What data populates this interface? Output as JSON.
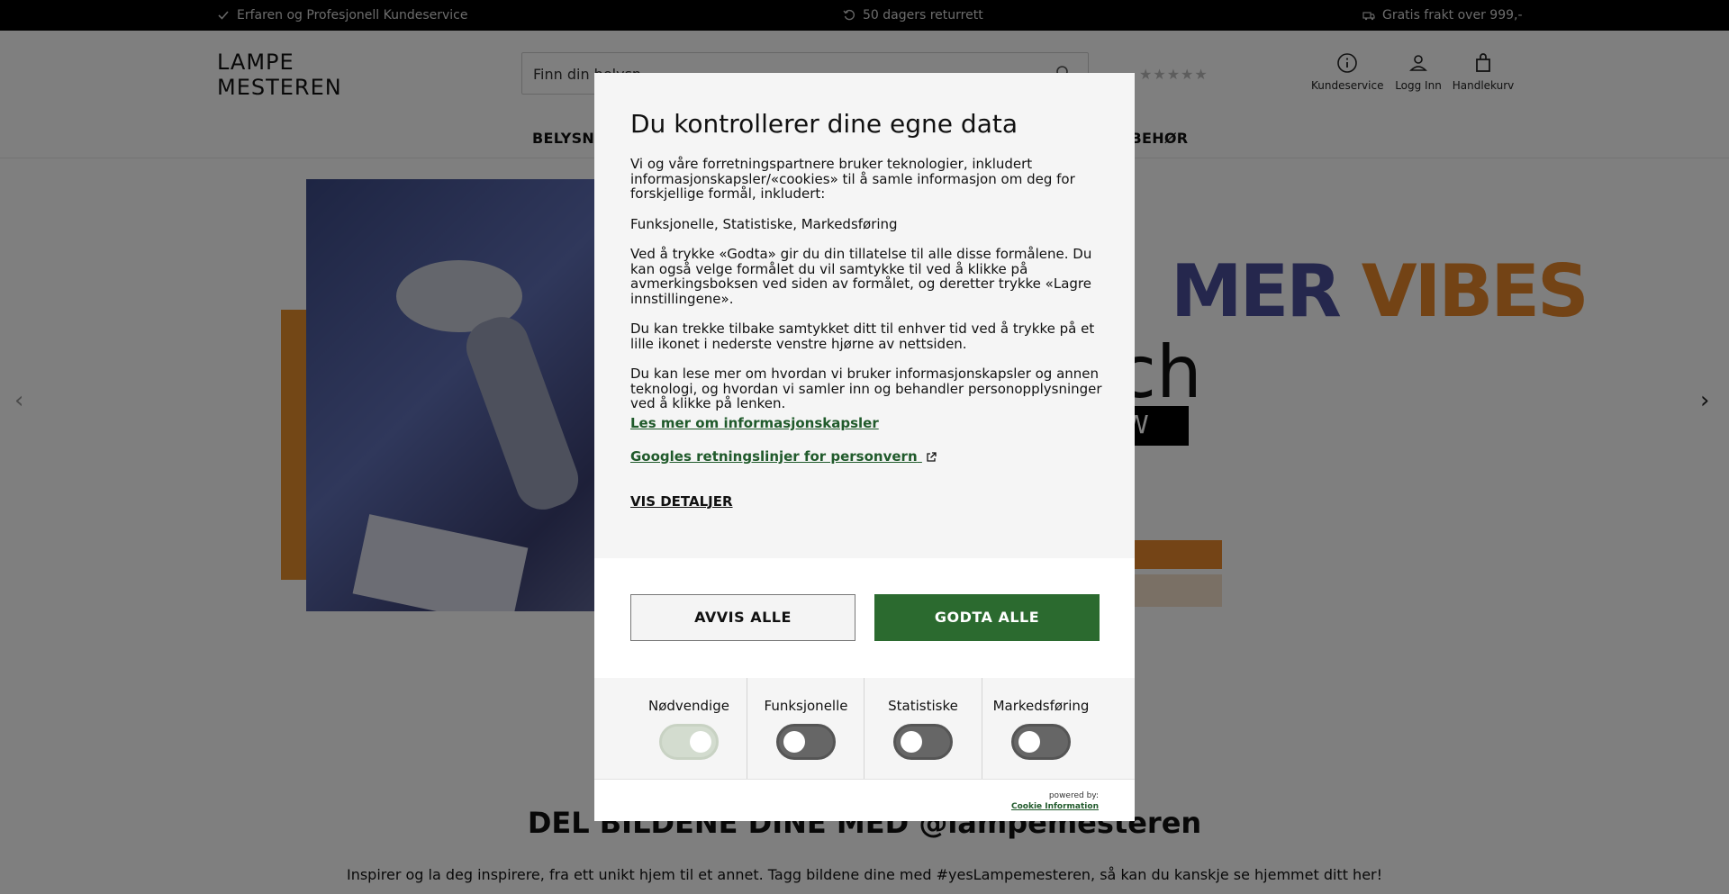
{
  "topbar": {
    "items": [
      {
        "icon": "check-icon",
        "label": "Erfaren og Profesjonell Kundeservice"
      },
      {
        "icon": "return-icon",
        "label": "50 dagers returrett"
      },
      {
        "icon": "truck-icon",
        "label": "Gratis frakt over 999,-"
      }
    ]
  },
  "header": {
    "logo_text": "LAMPE MESTEREN",
    "search": {
      "placeholder": "Finn din belysning",
      "value": "Finn din belysn"
    },
    "rating_stars": "★★★★★",
    "icons": [
      {
        "icon": "info-icon",
        "label": "Kundeservice"
      },
      {
        "icon": "user-icon",
        "label": "Logg Inn"
      },
      {
        "icon": "bag-icon",
        "label": "Handlekurv"
      }
    ],
    "nav": {
      "left": "BELYSNI",
      "right": "LBEHØR"
    }
  },
  "hero": {
    "headline_part1": "MER",
    "headline_part2": "VIBES",
    "subline": "ch",
    "button_text": "W",
    "prev_arrow": "‹",
    "next_arrow": "›"
  },
  "share": {
    "title": "DEL BILDENE DINE MED @lampemesteren",
    "subtitle": "Inspirer og la deg inspirere, fra ett unikt hjem til et annet. Tagg bildene dine med #yesLampemesteren, så kan du kanskje se hjemmet ditt her!"
  },
  "cookie_modal": {
    "title": "Du kontrollerer dine egne data",
    "paragraphs": [
      "Vi og våre forretningspartnere bruker teknologier, inkludert informasjonskapsler/«cookies» til å samle informasjon om deg for forskjellige formål, inkludert:",
      "Funksjonelle, Statistiske, Markedsføring",
      "Ved å trykke «Godta» gir du din tillatelse til alle disse formålene. Du kan også velge formålet du vil samtykke til ved å klikke på avmerkingsboksen ved siden av formålet, og deretter trykke «Lagre innstillingene».",
      "Du kan trekke tilbake samtykket ditt til enhver tid ved å trykke på et lille ikonet i nederste venstre hjørne av nettsiden.",
      "Du kan lese mer om hvordan vi bruker informasjonskapsler og annen teknologi, og hvordan vi samler inn og behandler personopplysninger ved å klikke på lenken."
    ],
    "link_cookies": "Les mer om informasjonskapsler",
    "link_google": "Googles retningslinjer for personvern",
    "details": "VIS DETALJER",
    "reject_all": "AVVIS ALLE",
    "accept_all": "GODTA ALLE",
    "categories": [
      {
        "label": "Nødvendige",
        "state": "on"
      },
      {
        "label": "Funksjonelle",
        "state": "off"
      },
      {
        "label": "Statistiske",
        "state": "off"
      },
      {
        "label": "Markedsføring",
        "state": "off"
      }
    ],
    "powered_by": "powered by:",
    "provider": "Cookie Information"
  },
  "colors": {
    "accent": "#2b6a2f",
    "link": "#205a2b",
    "topbar_bg": "#000000"
  }
}
